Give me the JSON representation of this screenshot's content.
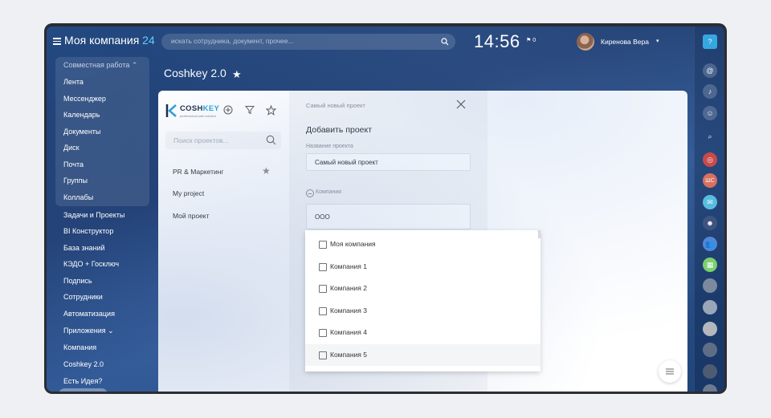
{
  "header": {
    "company_name": "Моя компания",
    "company_count": "24",
    "search_placeholder": "искать сотрудника, документ, прочее...",
    "clock": "14:56",
    "flag_count": "0",
    "user_name": "Киренова Вера"
  },
  "nav": {
    "group_title": "Совместная работа",
    "items": [
      "Лента",
      "Мессенджер",
      "Календарь",
      "Документы",
      "Диск",
      "Почта",
      "Группы",
      "Коллабы",
      "Задачи и Проекты",
      "BI Конструктор",
      "База знаний",
      "КЭДО + Госключ",
      "Подпись",
      "Сотрудники",
      "Автоматизация",
      "Приложения",
      "Компания",
      "Coshkey 2.0",
      "Есть Идея?"
    ],
    "active": "Coshkey 2.0"
  },
  "page": {
    "title": "Coshkey 2.0"
  },
  "projects": {
    "logo_a": "COSH",
    "logo_b": "KEY",
    "logo_sub": "professional sale solution",
    "search_placeholder": "Поиск проектов...",
    "list": [
      "PR & Маркетинг",
      "My project",
      "Мой проект"
    ]
  },
  "form": {
    "breadcrumb": "Самый новый проект",
    "heading": "Добавить проект",
    "name_label": "Название проекта",
    "name_value": "Самый новый проект",
    "company_label": "Компания",
    "company_value": "ООО"
  },
  "dropdown": {
    "options": [
      "Моя компания",
      "Компания 1",
      "Компания 2",
      "Компания 3",
      "Компания 4",
      "Компания 5"
    ],
    "highlighted": "Компания 5"
  },
  "rightbar": {
    "badge_text": "ШС"
  },
  "colors": {
    "accent": "#2ba1d8",
    "count": "#5fd0ff"
  }
}
